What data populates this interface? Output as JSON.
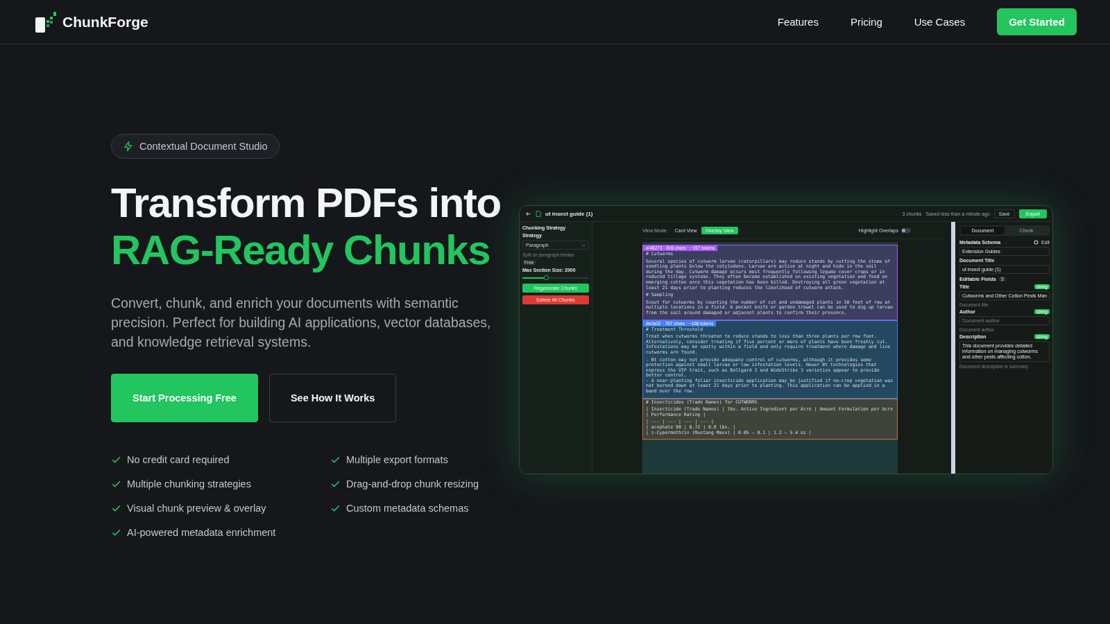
{
  "nav": {
    "brand": "ChunkForge",
    "links": [
      "Features",
      "Pricing",
      "Use Cases"
    ],
    "cta": "Get Started"
  },
  "hero": {
    "badge": "Contextual Document Studio",
    "title_line1": "Transform PDFs into",
    "title_line2": "RAG-Ready Chunks",
    "subtitle": "Convert, chunk, and enrich your documents with semantic precision. Perfect for building AI applications, vector databases, and knowledge retrieval systems.",
    "buttons": [
      {
        "label": "Start Processing Free",
        "kind": "primary"
      },
      {
        "label": "See How It Works",
        "kind": "secondary"
      }
    ],
    "features": [
      "No credit card required",
      "Multiple export formats",
      "Multiple chunking strategies",
      "Drag-and-drop chunk resizing",
      "Visual chunk preview & overlay",
      "Custom metadata schemas",
      "AI-powered metadata enrichment"
    ]
  },
  "app_preview": {
    "header": {
      "file_name": "ut insect guide (1)",
      "chunk_count": "3 chunks",
      "saved_status": "Saved less than a minute ago",
      "save": "Save",
      "export": "Export"
    },
    "left_panel": {
      "section_title": "Chunking Strategy",
      "strategy_label": "Strategy",
      "strategy_value": "Paragraph",
      "hint": "Split on paragraph breaks",
      "tag": "Free",
      "size_label": "Max Section Size: 2000",
      "size_slider": {
        "level": 0.35
      },
      "regenerate": "Regenerate Chunks",
      "delete": "Delete All Chunks"
    },
    "view": {
      "label": "View Mode:",
      "modes": [
        {
          "label": "Card View",
          "selected": false
        },
        {
          "label": "Overlay View",
          "selected": true
        }
      ],
      "highlight_label": "Highlight Overlaps",
      "highlight_on": false
    },
    "chunks": [
      {
        "tag": "a/48273 · 808 chars · ~157 tokens",
        "color": "#a855f7",
        "paragraphs": [
          "# Cutworms",
          "Several species of cutworm larvae (caterpillars) may reduce stands by cutting the stems of seedling plants below the cotyledons. Larvae are active at night and hide in the soil during the day. Cutworm damage occurs most frequently following legume cover crops or in reduced tillage systems. They often become established on existing vegetation and feed on emerging cotton once this vegetation has been killed. Destroying all green vegetation at least 21 days prior to planting reduces the likelihood of cutworm attack.",
          "# Sampling",
          "Scout for cutworms by counting the number of cut and undamaged plants in 50 feet of row at multiple locations in a field. A pocket knife or garden trowel can be used to dig up larvae from the soil around damaged or adjacent plants to confirm their presence."
        ]
      },
      {
        "tag": "de0a02 · 787 chars · ~168 tokens",
        "color": "#3b82f6",
        "paragraphs": [
          "# Treatment Threshold",
          "Treat when cutworms threaten to reduce stands to less than three plants per row foot. Alternatively, consider treating if five percent or more of plants have been freshly cut. Infestations may be spotty within a field and only require treatment where damage and live cutworms are found.",
          "- Bt cotton may not provide adequate control of cutworms, although it provides some protection against small larvae or low infestation levels. Newer Bt technologies that express the VIP trait, such as Bollgard 3 and WideStrike 3 varieties appear to provide better control.\n- A near-planting foliar insecticide application may be justified if no-crop vegetation was not burned down at least 21 days prior to planting. This application can be applied in a band over the row."
        ]
      },
      {
        "color": "#c2703a",
        "paragraphs": [
          "# Insecticides (Trade Names) for CUTWORMS",
          "| Insecticide (Trade Names) | lbs. Active Ingredient per Acre | Amount Formulation per Acre | Performance Rating |",
          "| --- | --- | --- | --- |\n| acephate 90 | 0.72 | 0.8 lbs. |\n| z-Cypermethrin (Mustang Maxx) | 0.05 – 0.1 | 1.2 – 5.4 oz |"
        ]
      }
    ],
    "right_panel": {
      "tabs": [
        {
          "label": "Document",
          "selected": true
        },
        {
          "label": "Chunk",
          "selected": false
        }
      ],
      "schema_label": "Metadata Schema",
      "edit": "Edit",
      "schema_value": "Extension Guides",
      "doc_title_label": "Document Title",
      "doc_title_value": "ut insect guide (1)",
      "fields_label": "Editable Fields",
      "fields_count": "5",
      "fields": [
        {
          "label": "Title",
          "type": "string",
          "value": "Cutworms and Other Cotton Pests Man",
          "hint": "Document title",
          "kind": "input"
        },
        {
          "label": "Author",
          "type": "string",
          "placeholder": "Document author",
          "hint": "Document author",
          "kind": "input"
        },
        {
          "label": "Description",
          "type": "string",
          "value": "This document provides detailed information on managing cutworms and other pests affecting cotton,",
          "hint": "Document description or summary",
          "kind": "textarea"
        }
      ]
    }
  }
}
